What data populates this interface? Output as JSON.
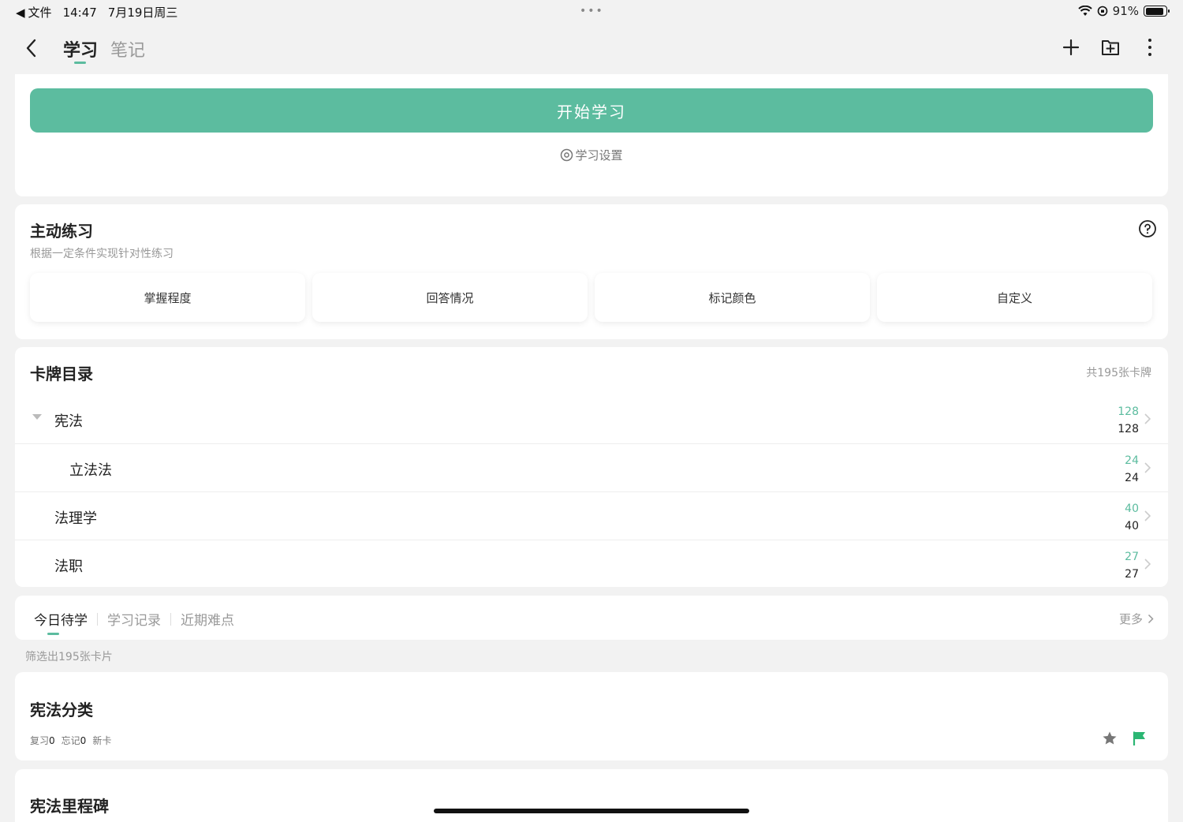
{
  "status_bar": {
    "back_app": "文件",
    "time": "14:47",
    "date": "7月19日周三",
    "dots": "•••",
    "battery": "91%",
    "battery_level": 0.91
  },
  "nav": {
    "tabs": [
      "学习",
      "笔记"
    ]
  },
  "start": {
    "button_label": "开始学习",
    "settings_label": "学习设置"
  },
  "practice": {
    "title": "主动练习",
    "subtitle": "根据一定条件实现针对性练习",
    "buttons": [
      "掌握程度",
      "回答情况",
      "标记颜色",
      "自定义"
    ]
  },
  "deck": {
    "title": "卡牌目录",
    "total": "共195张卡牌",
    "rows": [
      {
        "name": "宪法",
        "green": "128",
        "black": "128"
      },
      {
        "name": "立法法",
        "green": "24",
        "black": "24"
      },
      {
        "name": "法理学",
        "green": "40",
        "black": "40"
      },
      {
        "name": "法职",
        "green": "27",
        "black": "27"
      }
    ]
  },
  "today": {
    "tabs": [
      "今日待学",
      "学习记录",
      "近期难点"
    ],
    "more": "更多",
    "filter_text": "筛选出195张卡片"
  },
  "items": [
    {
      "title": "宪法分类",
      "review_label": "复习",
      "review_count": "0",
      "forget_label": "忘记",
      "forget_count": "0",
      "new_label": "新卡"
    },
    {
      "title": "宪法里程碑"
    }
  ],
  "colors": {
    "accent": "#5cbc9f",
    "background": "#f2f2f2"
  }
}
